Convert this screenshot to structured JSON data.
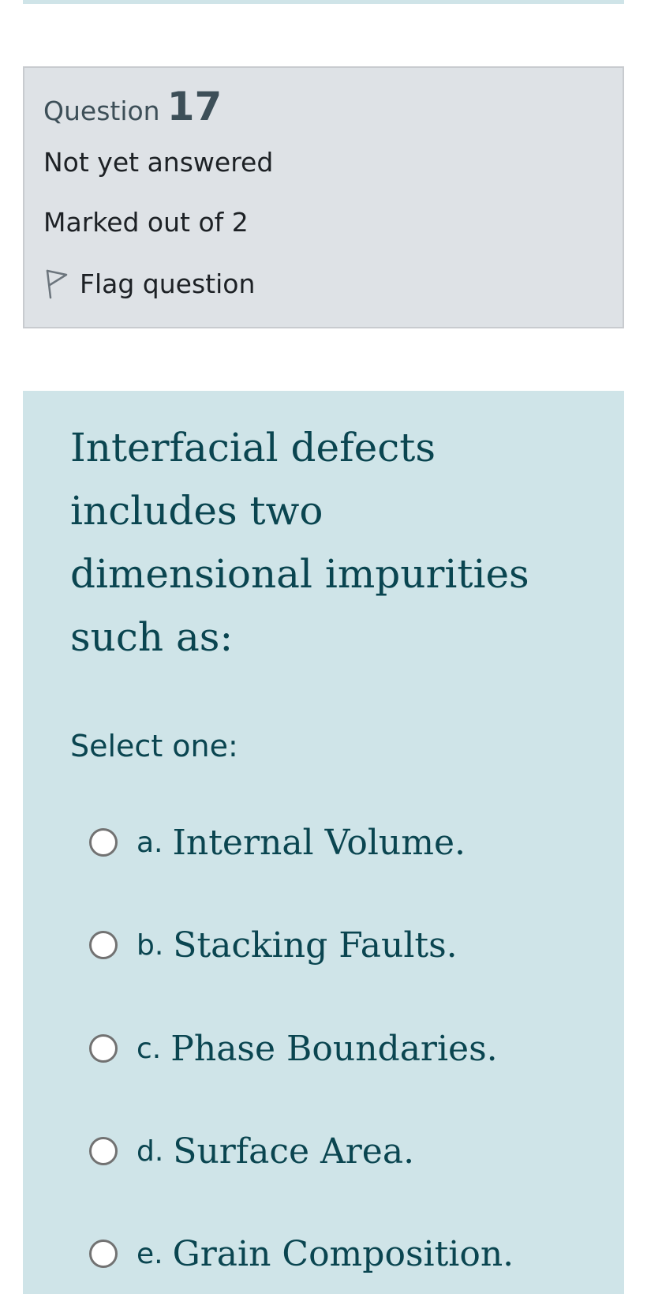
{
  "question_info": {
    "label": "Question",
    "number": "17",
    "state": "Not yet answered",
    "grade": "Marked out of 2",
    "flag_label": "Flag question",
    "flag_icon": "flag-outline-icon"
  },
  "question": {
    "text": "Interfacial defects includes two dimensional impurities such as:",
    "prompt": "Select one:",
    "options": [
      {
        "letter": "a.",
        "text": "Internal Volume.",
        "selected": false
      },
      {
        "letter": "b.",
        "text": "Stacking Faults.",
        "selected": false
      },
      {
        "letter": "c.",
        "text": "Phase Boundaries.",
        "selected": false
      },
      {
        "letter": "d.",
        "text": "Surface Area.",
        "selected": false
      },
      {
        "letter": "e.",
        "text": "Grain Composition.",
        "selected": false
      }
    ]
  },
  "colors": {
    "info_background": "#dee2e6",
    "content_background": "#cfe4e8",
    "question_text": "#0a4550",
    "heading_text": "#3d4f58"
  }
}
